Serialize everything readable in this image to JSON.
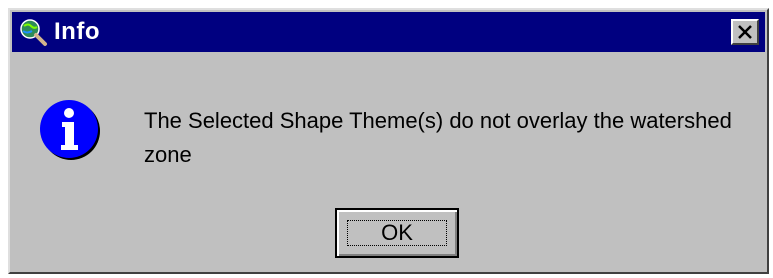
{
  "window": {
    "title": "Info",
    "icon": "globe-magnifier-icon",
    "close_icon": "close-icon"
  },
  "message": {
    "icon": "info-icon",
    "text": "The Selected Shape Theme(s) do not overlay the watershed zone"
  },
  "buttons": {
    "ok_label": "OK"
  },
  "colors": {
    "titlebar": "#000080",
    "dialog_face": "#c0c0c0",
    "info_icon_fill": "#0000ff"
  }
}
